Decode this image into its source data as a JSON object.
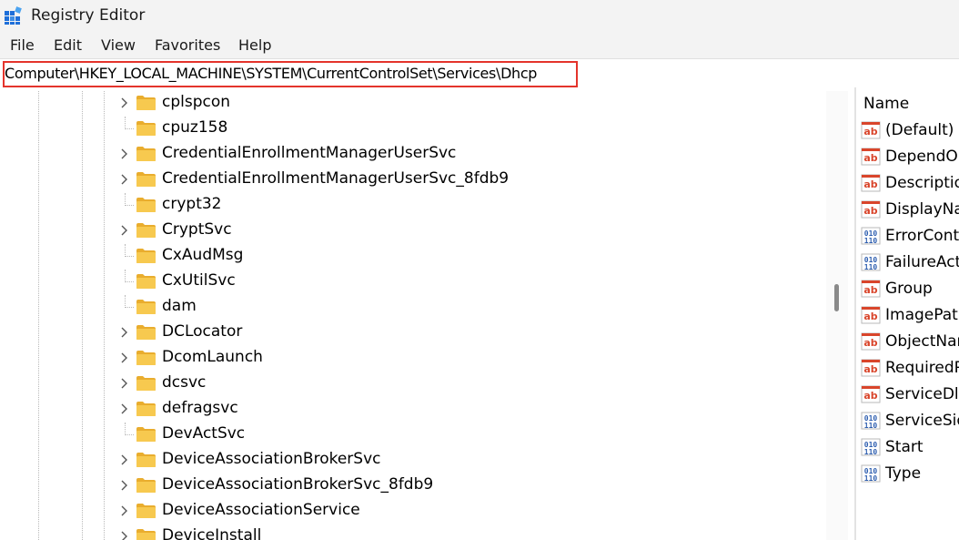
{
  "window": {
    "title": "Registry Editor"
  },
  "menu": [
    "File",
    "Edit",
    "View",
    "Favorites",
    "Help"
  ],
  "address": {
    "path": "Computer\\HKEY_LOCAL_MACHINE\\SYSTEM\\CurrentControlSet\\Services\\Dhcp"
  },
  "tree": {
    "items": [
      {
        "label": "cplspcon",
        "expandable": true
      },
      {
        "label": "cpuz158",
        "expandable": false
      },
      {
        "label": "CredentialEnrollmentManagerUserSvc",
        "expandable": true
      },
      {
        "label": "CredentialEnrollmentManagerUserSvc_8fdb9",
        "expandable": true
      },
      {
        "label": "crypt32",
        "expandable": false
      },
      {
        "label": "CryptSvc",
        "expandable": true
      },
      {
        "label": "CxAudMsg",
        "expandable": false
      },
      {
        "label": "CxUtilSvc",
        "expandable": false
      },
      {
        "label": "dam",
        "expandable": false
      },
      {
        "label": "DCLocator",
        "expandable": true
      },
      {
        "label": "DcomLaunch",
        "expandable": true
      },
      {
        "label": "dcsvc",
        "expandable": true
      },
      {
        "label": "defragsvc",
        "expandable": true
      },
      {
        "label": "DevActSvc",
        "expandable": false
      },
      {
        "label": "DeviceAssociationBrokerSvc",
        "expandable": true
      },
      {
        "label": "DeviceAssociationBrokerSvc_8fdb9",
        "expandable": true
      },
      {
        "label": "DeviceAssociationService",
        "expandable": true
      },
      {
        "label": "DeviceInstall",
        "expandable": true
      }
    ]
  },
  "values_pane": {
    "column_name": "Name",
    "items": [
      {
        "label": "(Default)",
        "type": "string"
      },
      {
        "label": "DependOn",
        "type": "string"
      },
      {
        "label": "Description",
        "type": "string"
      },
      {
        "label": "DisplayName",
        "type": "string"
      },
      {
        "label": "ErrorControl",
        "type": "binary"
      },
      {
        "label": "FailureActions",
        "type": "binary"
      },
      {
        "label": "Group",
        "type": "string"
      },
      {
        "label": "ImagePath",
        "type": "string"
      },
      {
        "label": "ObjectName",
        "type": "string"
      },
      {
        "label": "RequiredPrivileges",
        "type": "string"
      },
      {
        "label": "ServiceDll",
        "type": "string"
      },
      {
        "label": "ServiceSidType",
        "type": "binary"
      },
      {
        "label": "Start",
        "type": "binary"
      },
      {
        "label": "Type",
        "type": "binary"
      }
    ]
  },
  "colors": {
    "highlight_border": "#e4342c",
    "folder": "#f4c24b",
    "string_icon": "#d9452b",
    "binary_icon": "#2f5fb0"
  }
}
